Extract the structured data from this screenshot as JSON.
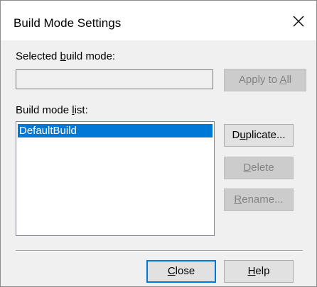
{
  "dialog": {
    "title": "Build Mode Settings"
  },
  "selected_build_mode": {
    "label_pre": "Selected ",
    "label_key": "b",
    "label_post": "uild mode:",
    "value": ""
  },
  "apply_to_all": {
    "label_pre": "Apply to ",
    "label_key": "A",
    "label_post": "ll"
  },
  "build_mode_list": {
    "label_pre": "Build mode ",
    "label_key": "l",
    "label_post": "ist:",
    "items": [
      "DefaultBuild"
    ],
    "selected_index": 0
  },
  "buttons": {
    "duplicate": {
      "pre": "D",
      "key": "u",
      "post": "plicate..."
    },
    "delete": {
      "pre": "",
      "key": "D",
      "post": "elete"
    },
    "rename": {
      "pre": "",
      "key": "R",
      "post": "ename..."
    },
    "close": {
      "pre": "",
      "key": "C",
      "post": "lose"
    },
    "help": {
      "pre": "",
      "key": "H",
      "post": "elp"
    }
  },
  "colors": {
    "selection": "#0078d7",
    "dialog_bg": "#f0f0f0",
    "disabled_text": "#838383"
  }
}
